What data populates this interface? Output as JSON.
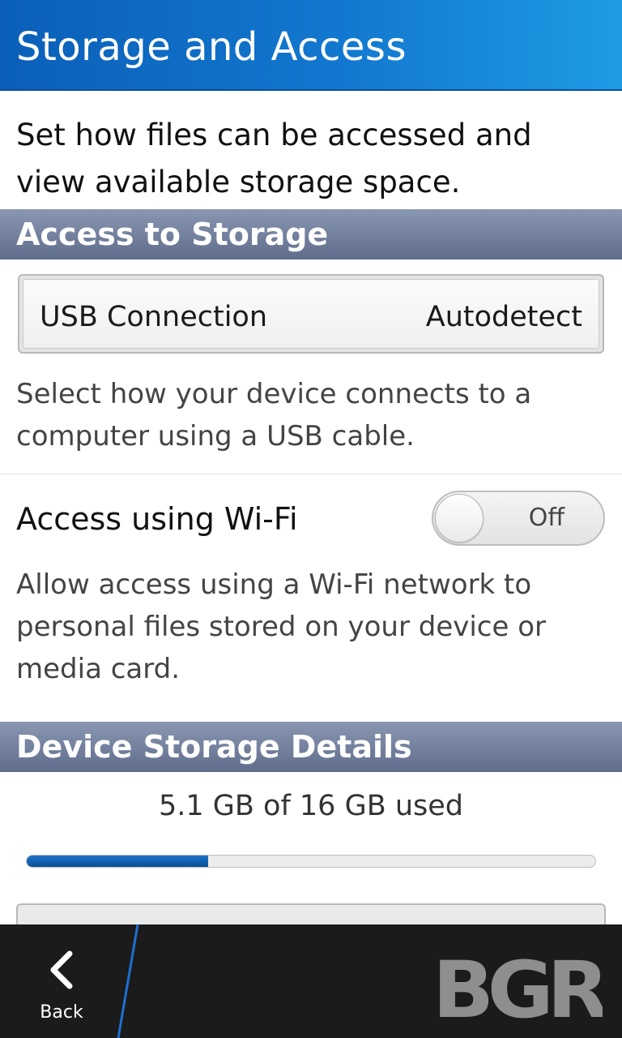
{
  "header": {
    "title": "Storage and Access"
  },
  "intro": "Set how files can be accessed and view available storage space.",
  "access_section": {
    "title": "Access to Storage",
    "usb": {
      "label": "USB Connection",
      "value": "Autodetect"
    },
    "usb_description": "Select how your device connects to a computer using a USB cable.",
    "wifi": {
      "label": "Access using Wi-Fi",
      "state": "Off"
    },
    "wifi_description": "Allow access using a Wi-Fi network to personal files stored on your device or media card."
  },
  "storage_section": {
    "title": "Device Storage Details",
    "usage_text": "5.1 GB of 16 GB used",
    "used_fraction": 0.319
  },
  "action_bar": {
    "back_label": "Back",
    "brand": "BGR"
  },
  "colors": {
    "title_bar": "#1278cf",
    "section_header": "#6b7995",
    "progress_fill": "#1565b8",
    "action_bar": "#1b1b1b",
    "brand_mark": "#8e8e8e"
  },
  "icons": {
    "back": "chevron-left-icon"
  }
}
